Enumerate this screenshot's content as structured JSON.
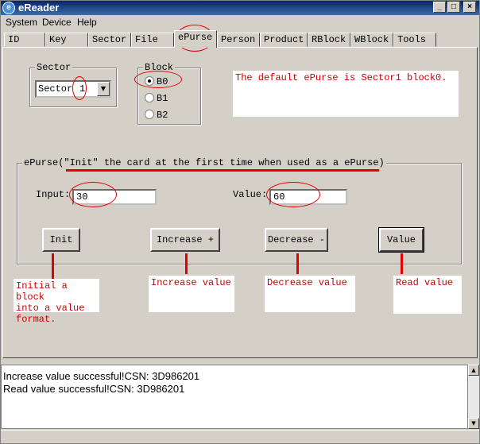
{
  "window": {
    "title": "eReader",
    "icon": "app-icon"
  },
  "menu": {
    "system": "System",
    "device": "Device",
    "help": "Help"
  },
  "tabs": [
    "ID",
    "Key",
    "Sector",
    "File",
    "ePurse",
    "Person",
    "Product",
    "RBlock",
    "WBlock",
    "Tools"
  ],
  "active_tab": "ePurse",
  "sector": {
    "title": "Sector",
    "label": "Sector",
    "value": "1"
  },
  "block": {
    "title": "Block",
    "options": [
      "B0",
      "B1",
      "B2"
    ],
    "selected": "B0"
  },
  "default_note": "The default ePurse is Sector1 block0.",
  "epurse": {
    "title": "ePurse(\"Init\" the  card at the first time when used as a ePurse)",
    "input_label": "Input:",
    "input_value": "30",
    "value_label": "Value:",
    "value_value": "60"
  },
  "buttons": {
    "init": "Init",
    "increase": "Increase +",
    "decrease": "Decrease -",
    "value": "Value"
  },
  "notes": {
    "init": "Initial a block\ninto a value\nformat.",
    "increase": "Increase value",
    "decrease": "Decrease value",
    "read": "Read value"
  },
  "log": [
    "Increase value successful!CSN: 3D986201",
    "Read value successful!CSN: 3D986201"
  ],
  "colors": {
    "annotation": "#e00000",
    "note_text": "#cc0000",
    "titlebar": "#0a246a"
  }
}
